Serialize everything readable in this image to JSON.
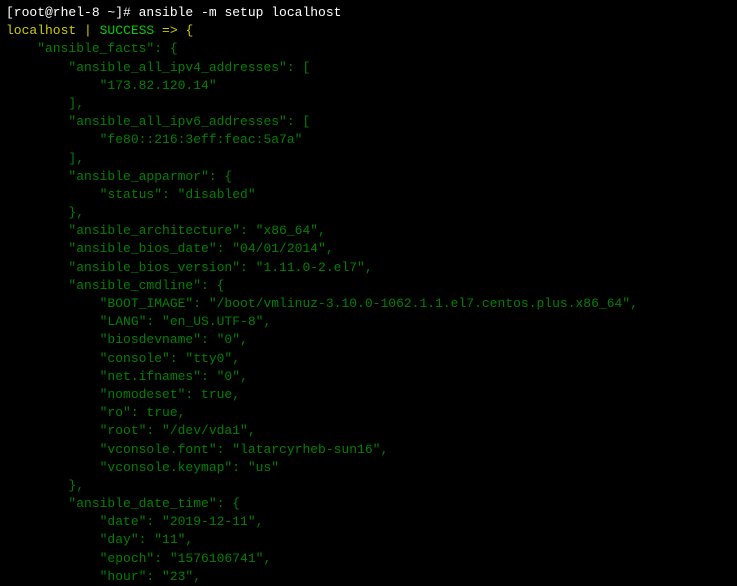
{
  "prompt": {
    "user_host": "[root@rhel-8 ~]# ",
    "command": "ansible -m setup localhost"
  },
  "result_header": {
    "host": "localhost",
    "sep": " | ",
    "status": "SUCCESS",
    "arrow": " => {"
  },
  "lines": [
    {
      "indent": "    ",
      "text": "\"ansible_facts\": {"
    },
    {
      "indent": "        ",
      "text": "\"ansible_all_ipv4_addresses\": ["
    },
    {
      "indent": "            ",
      "text": "\"173.82.120.14\""
    },
    {
      "indent": "        ",
      "text": "],"
    },
    {
      "indent": "        ",
      "text": "\"ansible_all_ipv6_addresses\": ["
    },
    {
      "indent": "            ",
      "text": "\"fe80::216:3eff:feac:5a7a\""
    },
    {
      "indent": "        ",
      "text": "],"
    },
    {
      "indent": "        ",
      "text": "\"ansible_apparmor\": {"
    },
    {
      "indent": "            ",
      "text": "\"status\": \"disabled\""
    },
    {
      "indent": "        ",
      "text": "},"
    },
    {
      "indent": "        ",
      "text": "\"ansible_architecture\": \"x86_64\","
    },
    {
      "indent": "        ",
      "text": "\"ansible_bios_date\": \"04/01/2014\","
    },
    {
      "indent": "        ",
      "text": "\"ansible_bios_version\": \"1.11.0-2.el7\","
    },
    {
      "indent": "        ",
      "text": "\"ansible_cmdline\": {"
    },
    {
      "indent": "            ",
      "text": "\"BOOT_IMAGE\": \"/boot/vmlinuz-3.10.0-1062.1.1.el7.centos.plus.x86_64\","
    },
    {
      "indent": "            ",
      "text": "\"LANG\": \"en_US.UTF-8\","
    },
    {
      "indent": "            ",
      "text": "\"biosdevname\": \"0\","
    },
    {
      "indent": "            ",
      "text": "\"console\": \"tty0\","
    },
    {
      "indent": "            ",
      "text": "\"net.ifnames\": \"0\","
    },
    {
      "indent": "            ",
      "text": "\"nomodeset\": true,"
    },
    {
      "indent": "            ",
      "text": "\"ro\": true,"
    },
    {
      "indent": "            ",
      "text": "\"root\": \"/dev/vda1\","
    },
    {
      "indent": "            ",
      "text": "\"vconsole.font\": \"latarcyrheb-sun16\","
    },
    {
      "indent": "            ",
      "text": "\"vconsole.keymap\": \"us\""
    },
    {
      "indent": "        ",
      "text": "},"
    },
    {
      "indent": "        ",
      "text": "\"ansible_date_time\": {"
    },
    {
      "indent": "            ",
      "text": "\"date\": \"2019-12-11\","
    },
    {
      "indent": "            ",
      "text": "\"day\": \"11\","
    },
    {
      "indent": "            ",
      "text": "\"epoch\": \"1576106741\","
    },
    {
      "indent": "            ",
      "text": "\"hour\": \"23\","
    }
  ]
}
